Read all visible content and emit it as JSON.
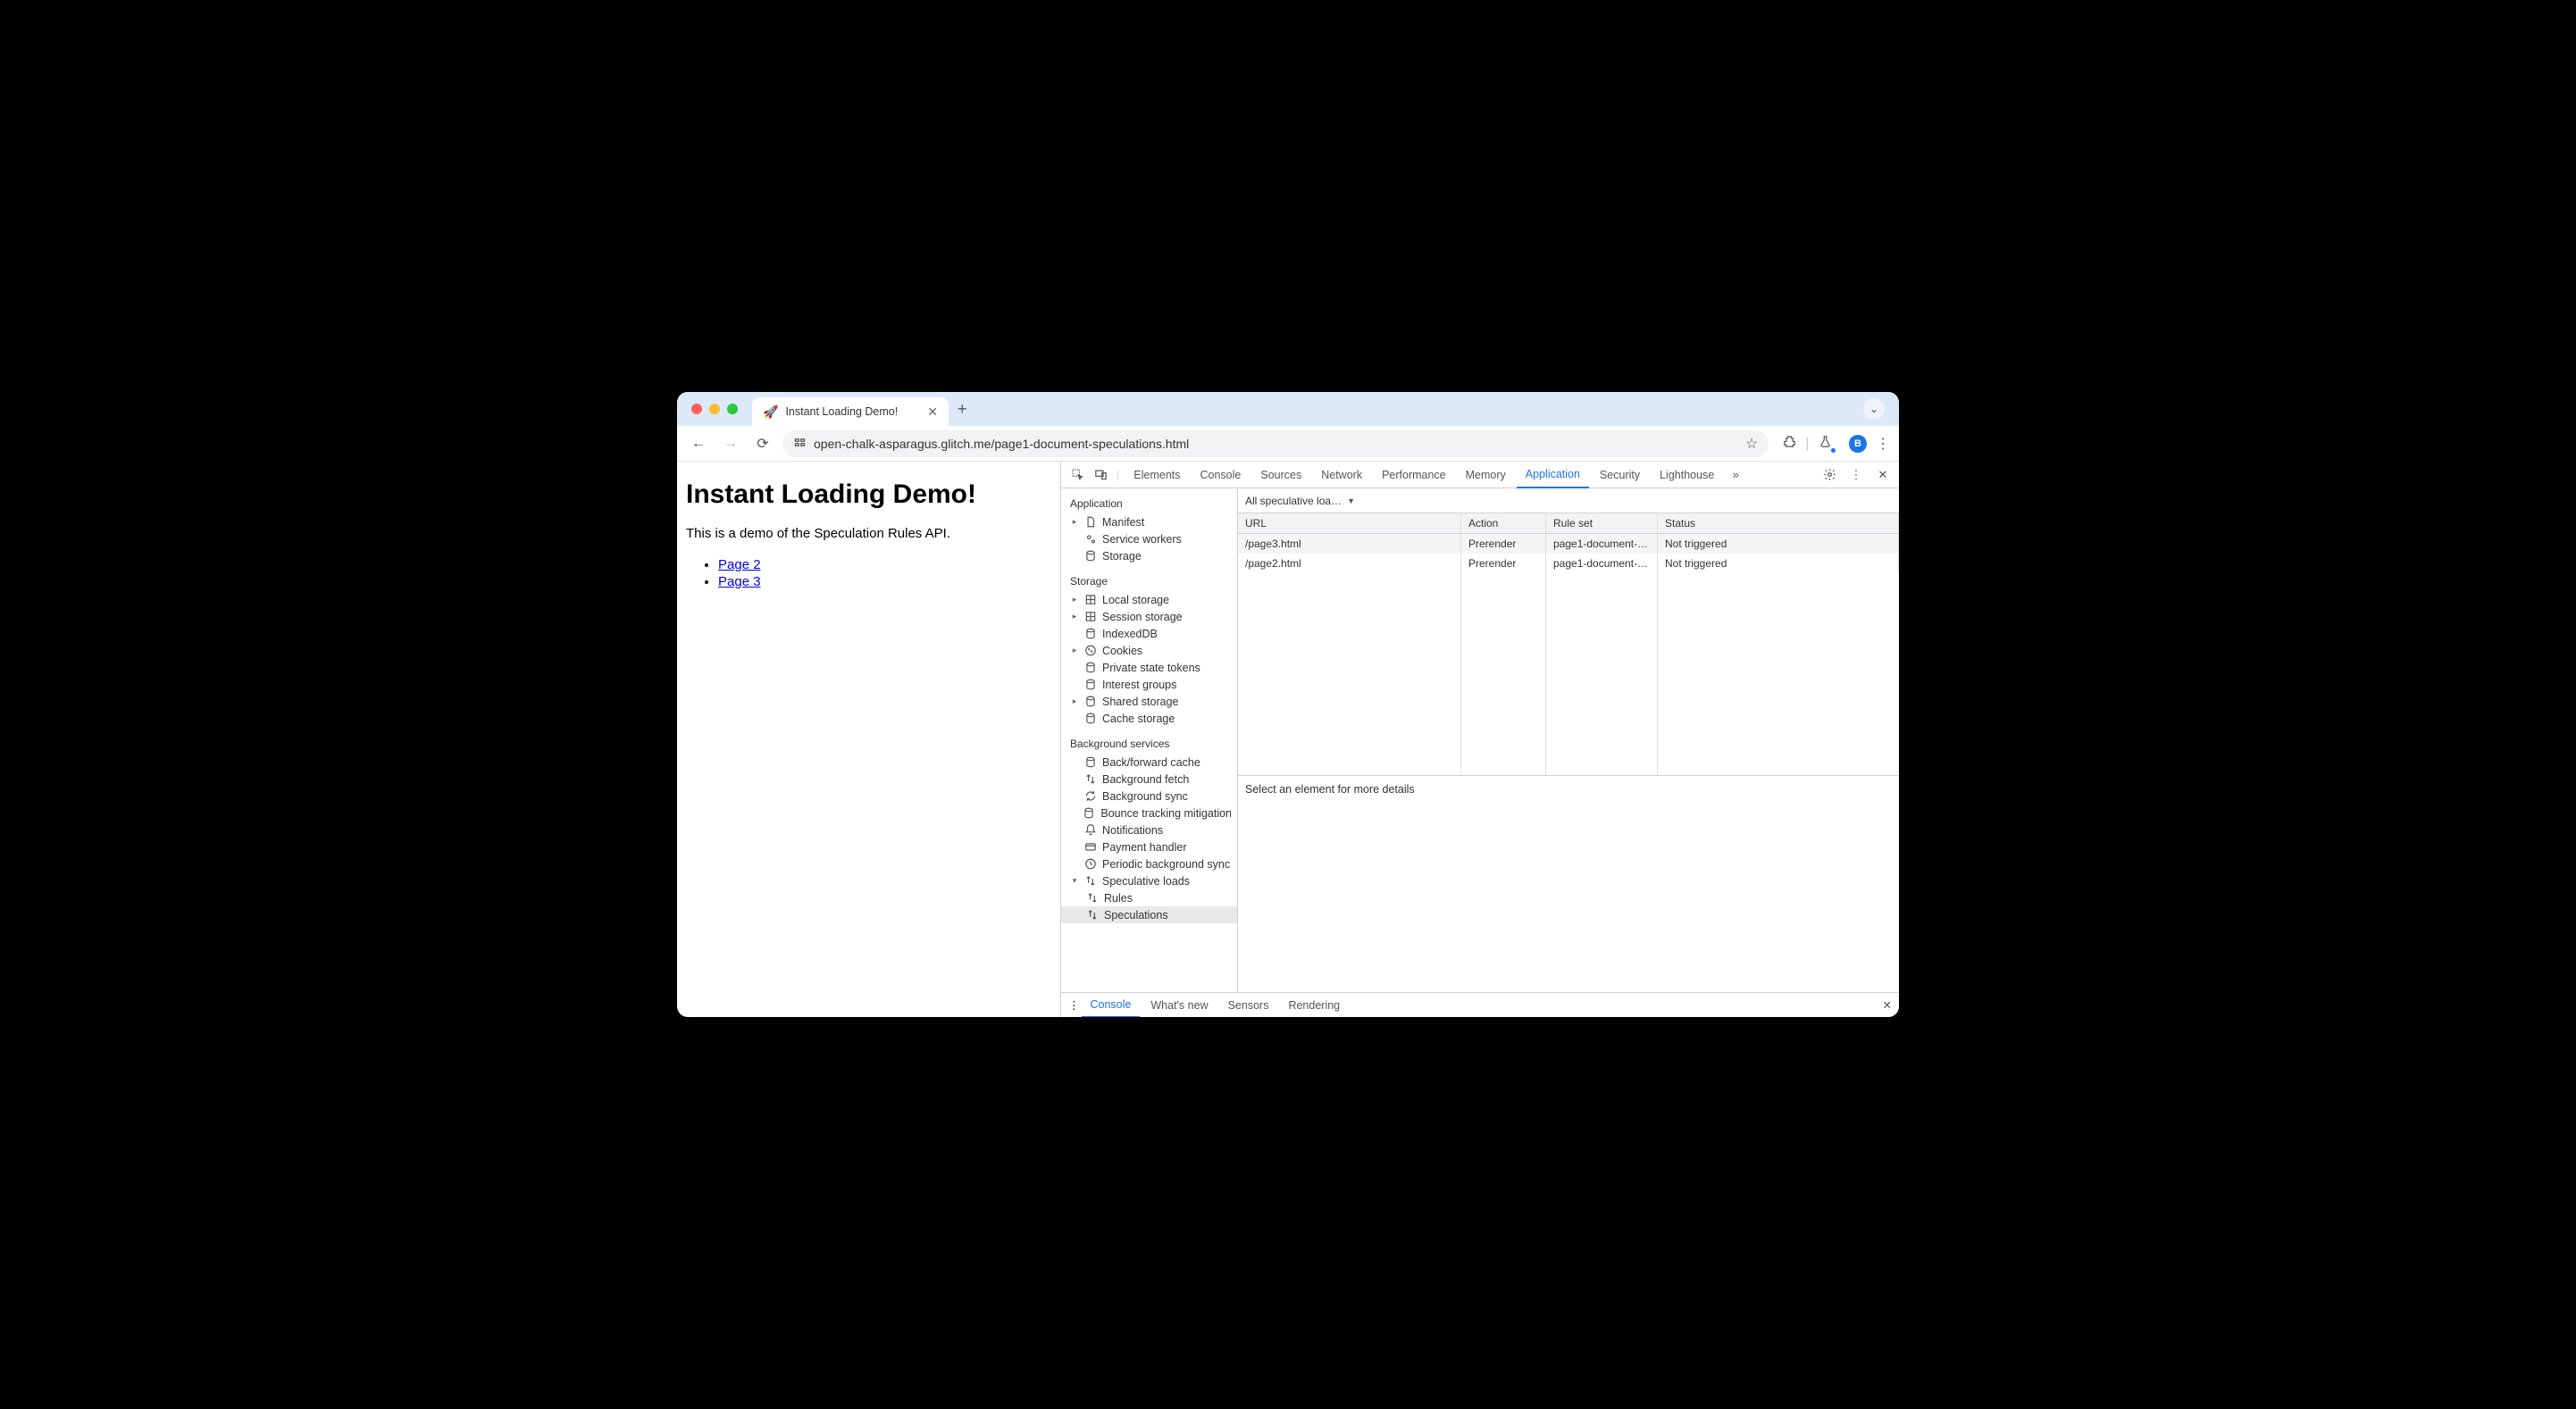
{
  "tab": {
    "favicon": "🚀",
    "title": "Instant Loading Demo!"
  },
  "url": "open-chalk-asparagus.glitch.me/page1-document-speculations.html",
  "avatar_letter": "B",
  "page": {
    "heading": "Instant Loading Demo!",
    "subtext": "This is a demo of the Speculation Rules API.",
    "links": [
      "Page 2",
      "Page 3"
    ]
  },
  "devtools": {
    "tabs": [
      "Elements",
      "Console",
      "Sources",
      "Network",
      "Performance",
      "Memory",
      "Application",
      "Security",
      "Lighthouse"
    ],
    "active_tab": "Application",
    "sidebar": {
      "application": {
        "label": "Application",
        "items": [
          "Manifest",
          "Service workers",
          "Storage"
        ]
      },
      "storage": {
        "label": "Storage",
        "items": [
          "Local storage",
          "Session storage",
          "IndexedDB",
          "Cookies",
          "Private state tokens",
          "Interest groups",
          "Shared storage",
          "Cache storage"
        ]
      },
      "background": {
        "label": "Background services",
        "items": [
          "Back/forward cache",
          "Background fetch",
          "Background sync",
          "Bounce tracking mitigation",
          "Notifications",
          "Payment handler",
          "Periodic background sync",
          "Speculative loads"
        ],
        "spec_children": [
          "Rules",
          "Speculations"
        ],
        "selected": "Speculations"
      }
    },
    "filter_label": "All speculative loa…",
    "table": {
      "headers": [
        "URL",
        "Action",
        "Rule set",
        "Status"
      ],
      "rows": [
        {
          "url": "/page3.html",
          "action": "Prerender",
          "ruleset": "page1-document-…",
          "status": "Not triggered"
        },
        {
          "url": "/page2.html",
          "action": "Prerender",
          "ruleset": "page1-document-…",
          "status": "Not triggered"
        }
      ]
    },
    "detail_hint": "Select an element for more details",
    "drawer": {
      "tabs": [
        "Console",
        "What's new",
        "Sensors",
        "Rendering"
      ],
      "active": "Console"
    }
  }
}
